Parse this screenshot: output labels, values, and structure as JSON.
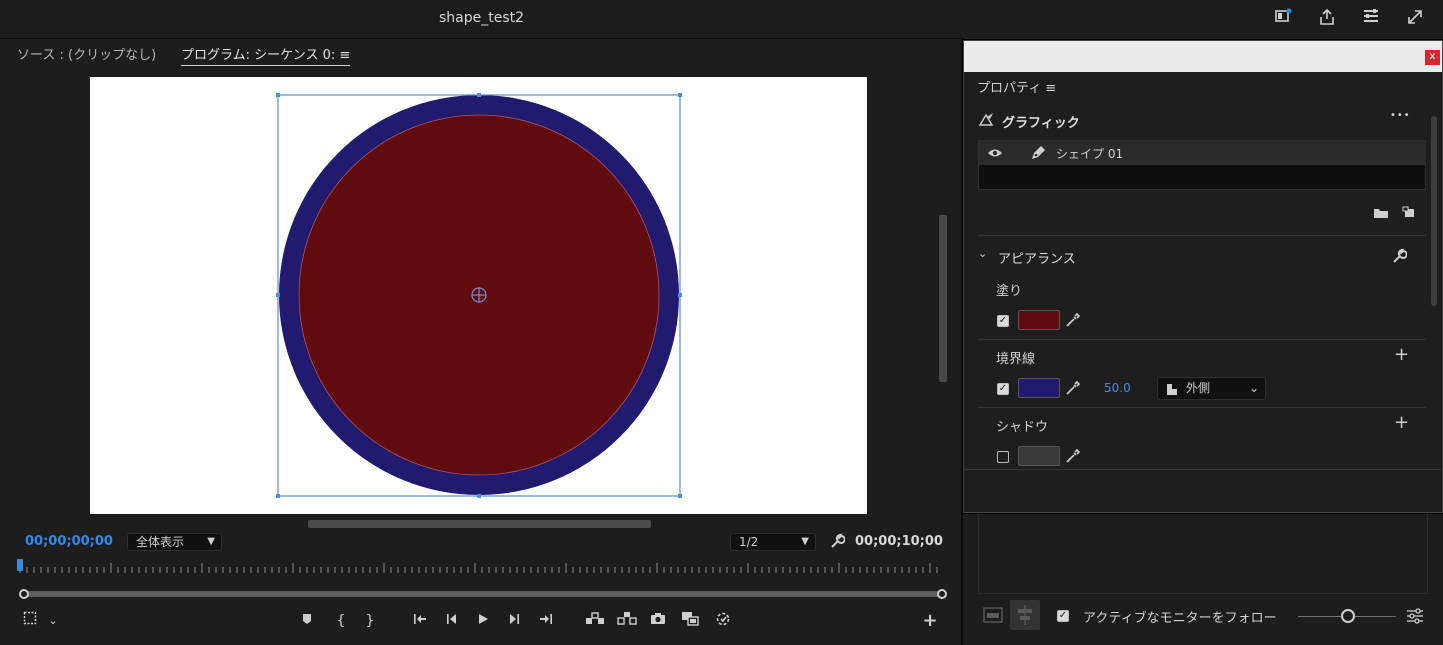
{
  "window": {
    "title": "shape_test2"
  },
  "monitor": {
    "source_tab": "ソース : (クリップなし)",
    "program_tab": "プログラム: シーケンス 0:",
    "menu_glyph": "≡",
    "current_timecode": "00;00;00;00",
    "duration_timecode": "00;00;10;00",
    "zoom_select": "全体表示",
    "resolution_select": "1/2"
  },
  "canvas": {
    "fill_color": "#600b0e",
    "stroke_color": "#221a6e",
    "background_color": "#ffffff"
  },
  "properties": {
    "panel_title": "プロパティ",
    "menu_glyph": "≡",
    "close_label": "x",
    "graphic_section": "グラフィック",
    "more_label": "•••",
    "layer_name": "シェイプ 01",
    "appearance_section": "アピアランス",
    "fill_label": "塗り",
    "fill_color": "#600b0e",
    "stroke_label": "境界線",
    "stroke_color": "#221a6e",
    "stroke_width": "50.0",
    "stroke_position": "外側",
    "shadow_label": "シャドウ",
    "shadow_color": "#3a3a3a"
  },
  "bottom_bar": {
    "follow_label": "アクティブなモニターをフォロー"
  }
}
